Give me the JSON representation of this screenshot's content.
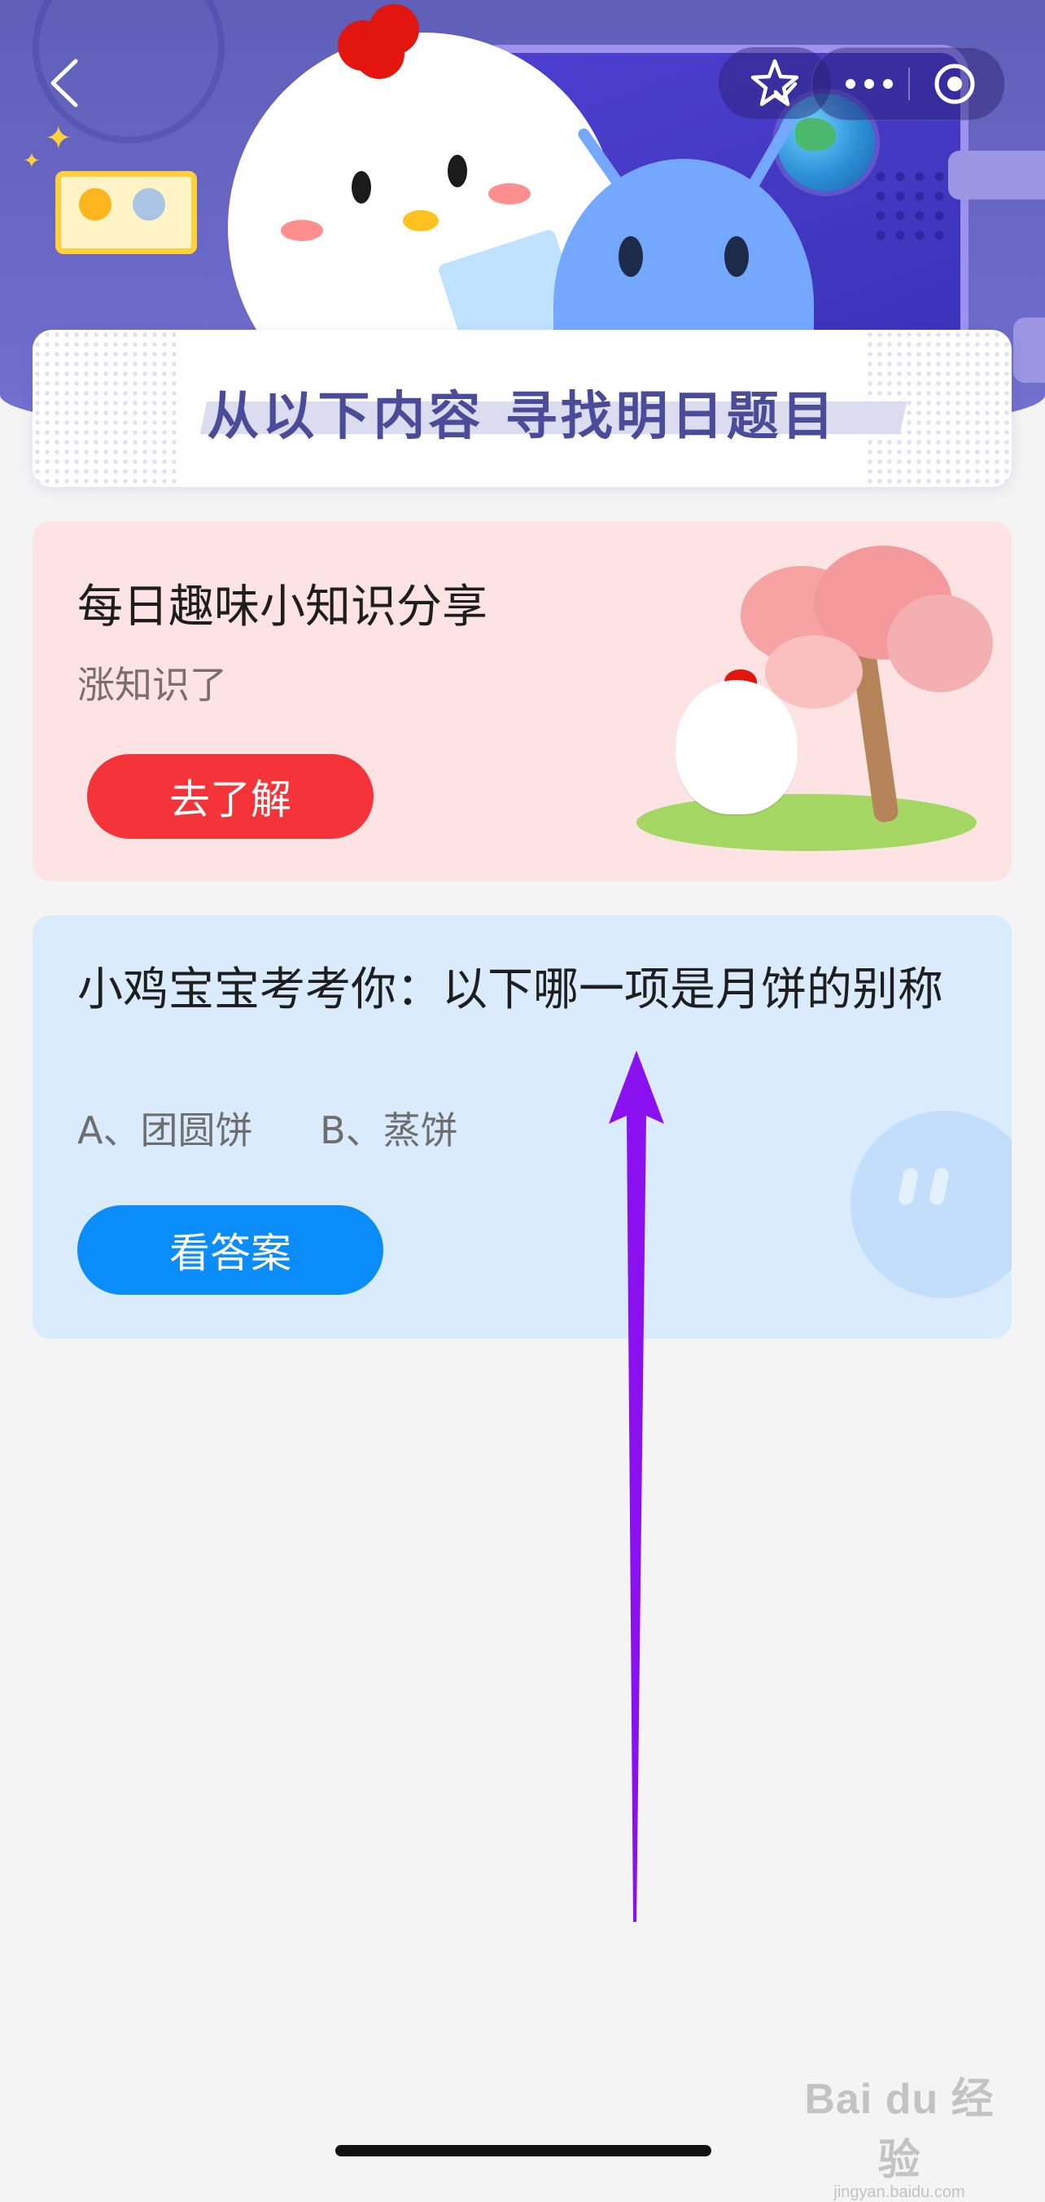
{
  "header": {
    "banner_title": "从以下内容  寻找明日题目",
    "icons": {
      "back": "chevron-left-icon",
      "favorite": "star-check-icon",
      "more": "more-dots-icon",
      "close": "target-circle-icon"
    }
  },
  "info_card": {
    "heading": "每日趣味小知识分享",
    "subheading": "涨知识了",
    "button_label": "去了解",
    "button_color": "#f43439",
    "background": "#fde3e4"
  },
  "quiz_card": {
    "question": "小鸡宝宝考考你：以下哪一项是月饼的别称",
    "options": [
      "A、团圆饼",
      "B、蒸饼"
    ],
    "button_label": "看答案",
    "button_color": "#0a8cfa",
    "background": "#d9ebfd"
  },
  "annotation": {
    "type": "arrow",
    "direction": "up",
    "color": "#8a10f0"
  },
  "watermark": {
    "main": "Bai du 经验",
    "sub": "jingyan.baidu.com"
  },
  "colors": {
    "banner": "#6b68c7",
    "page_background": "#f4f4f4",
    "title_text": "#4a4c9a"
  }
}
